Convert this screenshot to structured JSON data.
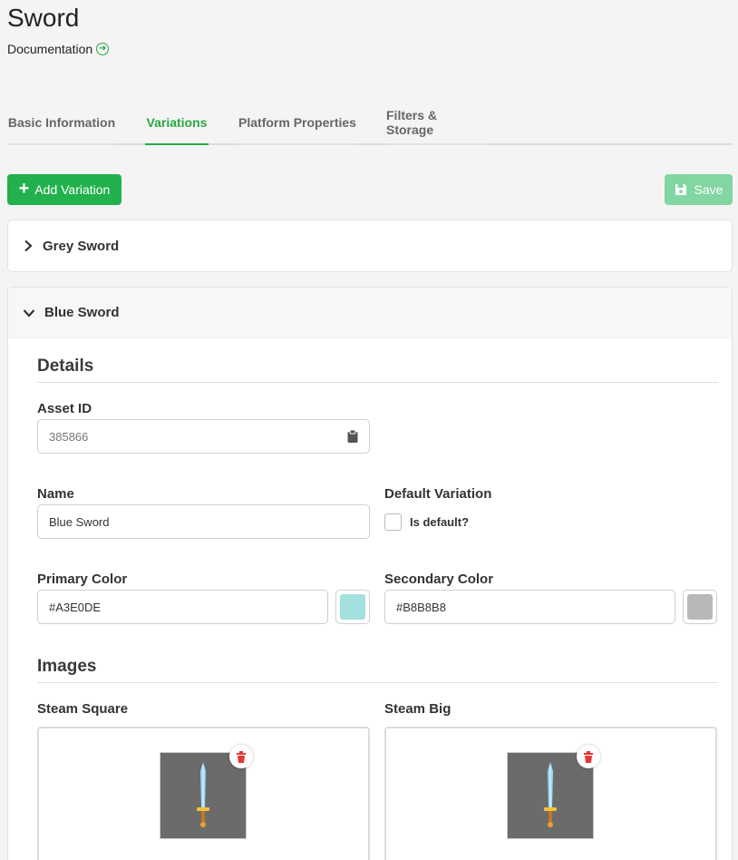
{
  "page": {
    "title": "Sword",
    "doc_link": "Documentation"
  },
  "tabs": [
    {
      "label": "Basic Information",
      "active": false
    },
    {
      "label": "Variations",
      "active": true
    },
    {
      "label": "Platform Properties",
      "active": false
    },
    {
      "label": "Filters & Storage",
      "active": false
    }
  ],
  "toolbar": {
    "add_label": "Add Variation",
    "save_label": "Save"
  },
  "variations": [
    {
      "name": "Grey Sword",
      "expanded": false
    },
    {
      "name": "Blue Sword",
      "expanded": true
    }
  ],
  "details": {
    "section_title": "Details",
    "asset_id_label": "Asset ID",
    "asset_id_value": "385866",
    "name_label": "Name",
    "name_value": "Blue Sword",
    "default_label": "Default Variation",
    "is_default_label": "Is default?",
    "is_default": false,
    "primary_color_label": "Primary Color",
    "primary_color_value": "#A3E0DE",
    "secondary_color_label": "Secondary Color",
    "secondary_color_value": "#B8B8B8"
  },
  "images": {
    "section_title": "Images",
    "steam_square_label": "Steam Square",
    "steam_big_label": "Steam Big"
  },
  "colors": {
    "accent": "#28a745",
    "add_button": "#22b14c",
    "save_button_disabled": "#82d6a1",
    "delete": "#e53935",
    "primary_swatch": "#A3E0DE",
    "secondary_swatch": "#B8B8B8"
  }
}
